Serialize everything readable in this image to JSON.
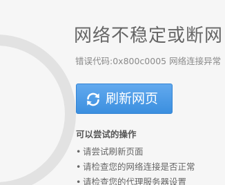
{
  "error_page": {
    "title": "网络不稳定或断网",
    "error_code_label": "错误代码:",
    "error_code": "0x800c0005",
    "error_desc": "网络连接异常"
  },
  "refresh_button": {
    "label": "刷新网页",
    "icon": "refresh-icon"
  },
  "suggestions": {
    "heading": "可以尝试的操作",
    "bullet": "•",
    "items": [
      "请尝试刷新页面",
      "请检查您的网络连接是否正常",
      "请检查您的代理服务器设置"
    ]
  },
  "colors": {
    "button_top": "#62a9ee",
    "button_bottom": "#3b8fdf",
    "background": "#f6f6f6",
    "title_text": "#666666"
  }
}
